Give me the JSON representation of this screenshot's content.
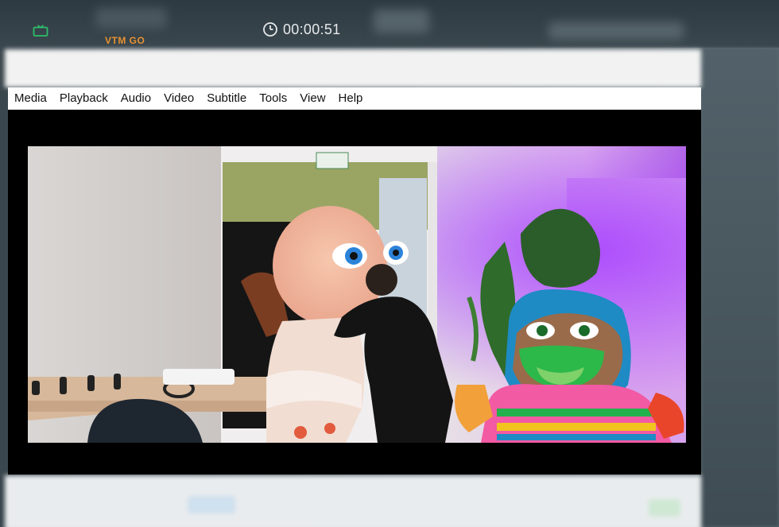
{
  "overlay": {
    "channel": "VTM GO",
    "timer": "00:00:51",
    "accent_color": "#e8912f",
    "tv_icon_color": "#2fbf6b",
    "icons": [
      "tv-icon",
      "clock-icon"
    ]
  },
  "menu": {
    "items": [
      "Media",
      "Playback",
      "Audio",
      "Video",
      "Subtitle",
      "Tools",
      "View",
      "Help"
    ]
  }
}
